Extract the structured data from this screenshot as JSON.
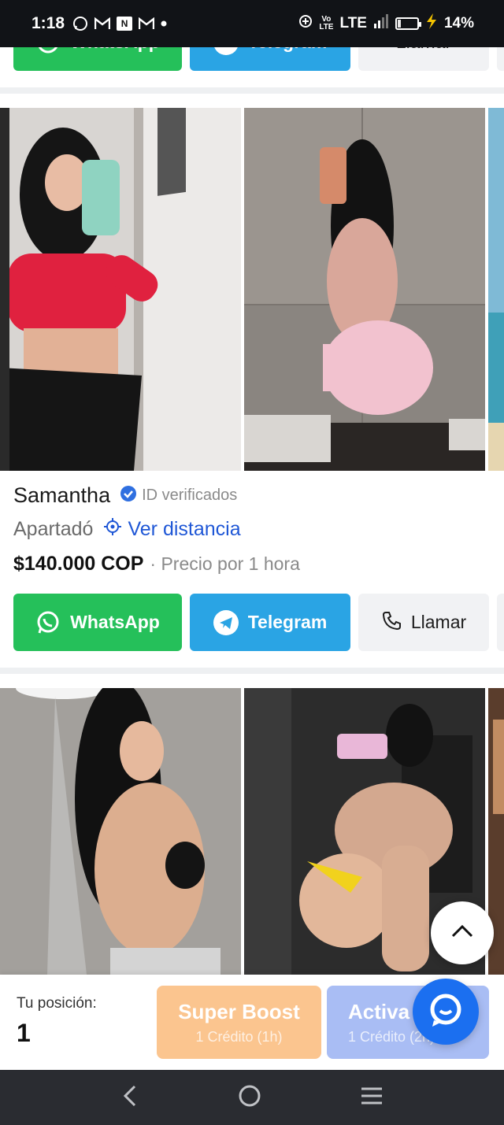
{
  "status_bar": {
    "time": "1:18",
    "icons_left": [
      "whatsapp-icon",
      "gmail-icon",
      "news-icon",
      "gmail-icon",
      "dot-icon"
    ],
    "network": "LTE",
    "battery": "14%",
    "battery_level": 0.14
  },
  "top_buttons": {
    "whatsapp": "WhatsApp",
    "telegram": "Telegram",
    "call": "Llamar"
  },
  "listing": {
    "name": "Samantha",
    "verified_label": "ID verificados",
    "city": "Apartadó",
    "distance_label": "Ver distancia",
    "price": "$140.000 COP",
    "price_note": "· Precio por 1 hora",
    "buttons": {
      "whatsapp": "WhatsApp",
      "telegram": "Telegram",
      "call": "Llamar"
    }
  },
  "bottom_panel": {
    "position_label": "Tu posición:",
    "position_value": "1",
    "super_boost_title": "Super Boost",
    "super_boost_sub": "1 Crédito (1h)",
    "activa_title": "Activa",
    "activa_sub": "1 Crédito (2h)"
  },
  "colors": {
    "whatsapp": "#25c05a",
    "telegram": "#2aa4e4",
    "link": "#1f57d6",
    "super_boost": "#fbc58f",
    "activa": "#a9bdf4",
    "chat_fab": "#1b6ff0"
  }
}
